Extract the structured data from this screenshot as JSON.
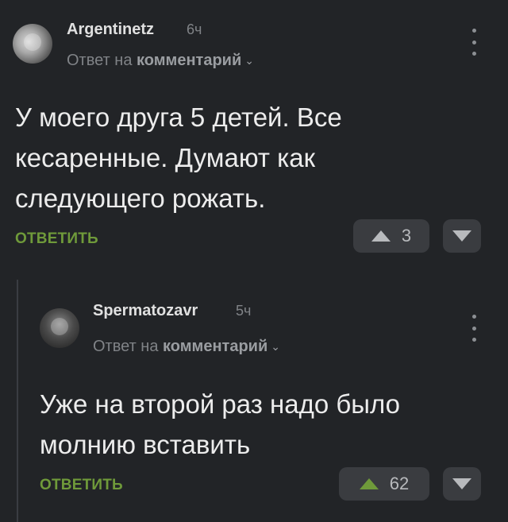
{
  "colors": {
    "background": "#222427",
    "accent_green": "#6f9a3a",
    "muted_text": "#808387",
    "vote_bg": "#3a3c40"
  },
  "comments": [
    {
      "username": "Argentinetz",
      "time": "6ч",
      "reply_prefix": "Ответ на",
      "reply_target": "комментарий",
      "text_lines": [
        "У моего друга 5 детей. Все",
        "кесаренные. Думают как",
        "следующего рожать."
      ],
      "reply_label": "ОТВЕТИТЬ",
      "upvotes": "3",
      "icons": {
        "avatar": "avatar",
        "menu": "more-vertical-icon",
        "up": "triangle-up-icon",
        "down": "triangle-down-icon"
      }
    },
    {
      "username": "Spermatozavr",
      "time": "5ч",
      "reply_prefix": "Ответ на",
      "reply_target": "комментарий",
      "text_lines": [
        "Уже на второй раз надо было",
        "молнию вставить"
      ],
      "reply_label": "ОТВЕТИТЬ",
      "upvotes": "62",
      "icons": {
        "avatar": "avatar",
        "menu": "more-vertical-icon",
        "up": "triangle-up-icon",
        "down": "triangle-down-icon"
      }
    }
  ]
}
